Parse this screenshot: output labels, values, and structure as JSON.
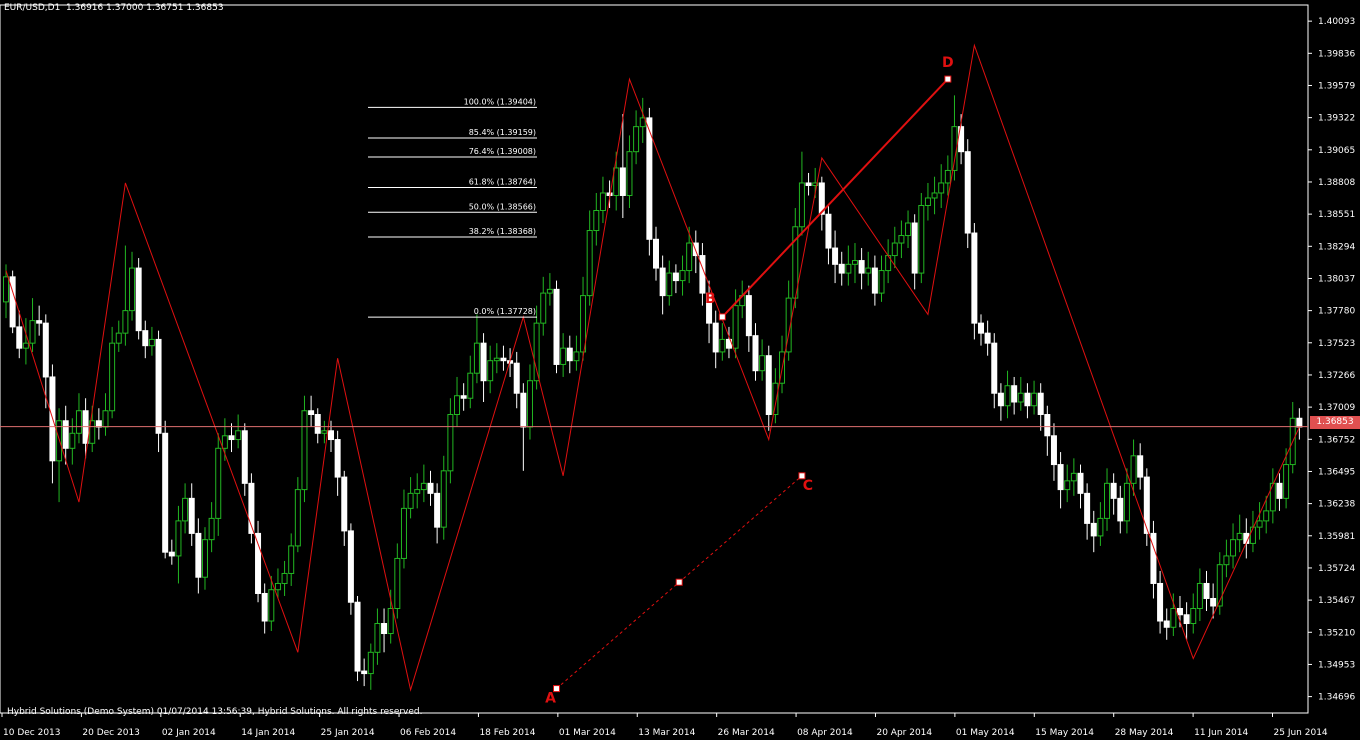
{
  "header": {
    "symbol": "EUR/USD,D1",
    "open": "1.36916",
    "high": "1.37000",
    "low": "1.36751",
    "close": "1.36853"
  },
  "footer": "Hybrid Solutions (Demo System) 01/07/2014 13:56:39, Hybrid Solutions. All rights reserved.",
  "current_price": "1.36853",
  "colors": {
    "background": "#000000",
    "bull": "#22b722",
    "bear": "#ffffff",
    "zigzag": "#e01010",
    "price_line": "#e07070",
    "axis_text": "#ffffff",
    "pattern_label": "#e01010"
  },
  "price_axis": [
    "1.40093",
    "1.39836",
    "1.39579",
    "1.39322",
    "1.39065",
    "1.38808",
    "1.38551",
    "1.38294",
    "1.38037",
    "1.37780",
    "1.37523",
    "1.37266",
    "1.37009",
    "1.36752",
    "1.36495",
    "1.36238",
    "1.35981",
    "1.35724",
    "1.35467",
    "1.35210",
    "1.34953",
    "1.34696"
  ],
  "time_axis": [
    "10 Dec 2013",
    "20 Dec 2013",
    "02 Jan 2014",
    "14 Jan 2014",
    "25 Jan 2014",
    "06 Feb 2014",
    "18 Feb 2014",
    "01 Mar 2014",
    "13 Mar 2014",
    "26 Mar 2014",
    "08 Apr 2014",
    "20 Apr 2014",
    "01 May 2014",
    "15 May 2014",
    "28 May 2014",
    "11 Jun 2014",
    "25 Jun 2014"
  ],
  "fib_levels": [
    {
      "label": "100.0% (1.39404)",
      "price": 1.39404
    },
    {
      "label": "85.4% (1.39159)",
      "price": 1.39159
    },
    {
      "label": "76.4% (1.39008)",
      "price": 1.39008
    },
    {
      "label": "61.8% (1.38764)",
      "price": 1.38764
    },
    {
      "label": "50.0% (1.38566)",
      "price": 1.38566
    },
    {
      "label": "38.2% (1.38368)",
      "price": 1.38368
    },
    {
      "label": "0.0% (1.37728)",
      "price": 1.37728
    }
  ],
  "pattern_points": [
    {
      "name": "A",
      "price": 1.3476
    },
    {
      "name": "B",
      "price": 1.3773
    },
    {
      "name": "C",
      "price": 1.3646
    },
    {
      "name": "D",
      "price": 1.3963
    }
  ],
  "chart_data": {
    "type": "candlestick",
    "symbol": "EUR/USD,D1",
    "ylim": [
      1.3455,
      1.402
    ],
    "zigzag": [
      1.381,
      1.3625,
      1.388,
      1.3505,
      1.374,
      1.3475,
      1.3773,
      1.3646,
      1.3963,
      1.3675,
      1.39,
      1.3775,
      1.399,
      1.35,
      1.3685
    ],
    "candles": [
      [
        1.3785,
        1.3805,
        1.3815,
        1.3772
      ],
      [
        1.3805,
        1.3765,
        1.381,
        1.376
      ],
      [
        1.3765,
        1.3748,
        1.3778,
        1.374
      ],
      [
        1.3748,
        1.3752,
        1.3772,
        1.3735
      ],
      [
        1.3752,
        1.377,
        1.3788,
        1.3745
      ],
      [
        1.377,
        1.3768,
        1.3782,
        1.3758
      ],
      [
        1.3768,
        1.3725,
        1.3775,
        1.37
      ],
      [
        1.3725,
        1.3658,
        1.3735,
        1.364
      ],
      [
        1.3658,
        1.369,
        1.37,
        1.3625
      ],
      [
        1.369,
        1.3668,
        1.3702,
        1.3655
      ],
      [
        1.3668,
        1.368,
        1.3692,
        1.3655
      ],
      [
        1.368,
        1.3698,
        1.3712,
        1.3672
      ],
      [
        1.3698,
        1.3672,
        1.3708,
        1.366
      ],
      [
        1.3672,
        1.369,
        1.3702,
        1.3665
      ],
      [
        1.369,
        1.3685,
        1.37,
        1.3675
      ],
      [
        1.3685,
        1.3698,
        1.3712,
        1.3678
      ],
      [
        1.3698,
        1.3752,
        1.3765,
        1.3692
      ],
      [
        1.3752,
        1.376,
        1.377,
        1.3745
      ],
      [
        1.376,
        1.3778,
        1.383,
        1.375
      ],
      [
        1.3778,
        1.3812,
        1.3825,
        1.377
      ],
      [
        1.3812,
        1.3762,
        1.382,
        1.3755
      ],
      [
        1.3762,
        1.375,
        1.377,
        1.374
      ],
      [
        1.375,
        1.3755,
        1.3765,
        1.3742
      ],
      [
        1.3755,
        1.368,
        1.3762,
        1.3665
      ],
      [
        1.368,
        1.3585,
        1.369,
        1.358
      ],
      [
        1.3585,
        1.3582,
        1.3595,
        1.3575
      ],
      [
        1.3582,
        1.361,
        1.3622,
        1.356
      ],
      [
        1.361,
        1.3628,
        1.364,
        1.36
      ],
      [
        1.3628,
        1.36,
        1.364,
        1.359
      ],
      [
        1.36,
        1.3565,
        1.3612,
        1.3552
      ],
      [
        1.3565,
        1.3595,
        1.3605,
        1.3555
      ],
      [
        1.3595,
        1.3612,
        1.3625,
        1.3585
      ],
      [
        1.3612,
        1.3668,
        1.368,
        1.3598
      ],
      [
        1.3668,
        1.3678,
        1.3692,
        1.3658
      ],
      [
        1.3678,
        1.3675,
        1.3688,
        1.3665
      ],
      [
        1.3675,
        1.3682,
        1.3695,
        1.3668
      ],
      [
        1.3682,
        1.364,
        1.3688,
        1.363
      ],
      [
        1.364,
        1.36,
        1.3648,
        1.3592
      ],
      [
        1.36,
        1.3552,
        1.361,
        1.3545
      ],
      [
        1.3552,
        1.353,
        1.356,
        1.352
      ],
      [
        1.353,
        1.3555,
        1.3566,
        1.3522
      ],
      [
        1.3555,
        1.356,
        1.3572,
        1.3548
      ],
      [
        1.356,
        1.3568,
        1.3578,
        1.355
      ],
      [
        1.3568,
        1.359,
        1.36,
        1.3558
      ],
      [
        1.359,
        1.3635,
        1.3645,
        1.3585
      ],
      [
        1.3635,
        1.3698,
        1.371,
        1.3625
      ],
      [
        1.3698,
        1.3695,
        1.371,
        1.3685
      ],
      [
        1.3695,
        1.368,
        1.37,
        1.3672
      ],
      [
        1.368,
        1.3682,
        1.369,
        1.3672
      ],
      [
        1.3682,
        1.3675,
        1.369,
        1.3665
      ],
      [
        1.3675,
        1.3645,
        1.3682,
        1.363
      ],
      [
        1.3645,
        1.3602,
        1.365,
        1.359
      ],
      [
        1.3602,
        1.3545,
        1.3608,
        1.3535
      ],
      [
        1.3545,
        1.349,
        1.355,
        1.3482
      ],
      [
        1.349,
        1.3488,
        1.35,
        1.3478
      ],
      [
        1.3488,
        1.3505,
        1.3512,
        1.3475
      ],
      [
        1.3505,
        1.3528,
        1.354,
        1.3495
      ],
      [
        1.3528,
        1.352,
        1.354,
        1.3505
      ],
      [
        1.352,
        1.354,
        1.3555,
        1.3512
      ],
      [
        1.354,
        1.358,
        1.3592,
        1.3532
      ],
      [
        1.358,
        1.362,
        1.3635,
        1.3572
      ],
      [
        1.362,
        1.3632,
        1.3645,
        1.3612
      ],
      [
        1.3632,
        1.3635,
        1.3648,
        1.362
      ],
      [
        1.3635,
        1.364,
        1.3655,
        1.3625
      ],
      [
        1.364,
        1.3632,
        1.365,
        1.3622
      ],
      [
        1.3632,
        1.3605,
        1.364,
        1.3592
      ],
      [
        1.3605,
        1.365,
        1.3662,
        1.3595
      ],
      [
        1.365,
        1.3695,
        1.3708,
        1.364
      ],
      [
        1.3695,
        1.371,
        1.3725,
        1.3685
      ],
      [
        1.371,
        1.3708,
        1.372,
        1.3698
      ],
      [
        1.3708,
        1.3728,
        1.3742,
        1.37
      ],
      [
        1.3728,
        1.3752,
        1.3775,
        1.372
      ],
      [
        1.3752,
        1.3722,
        1.376,
        1.3705
      ],
      [
        1.3722,
        1.3738,
        1.375,
        1.3712
      ],
      [
        1.3738,
        1.374,
        1.3752,
        1.3728
      ],
      [
        1.374,
        1.3738,
        1.375,
        1.373
      ],
      [
        1.3738,
        1.3736,
        1.3748,
        1.3725
      ],
      [
        1.3736,
        1.3712,
        1.3745,
        1.37
      ],
      [
        1.3712,
        1.3685,
        1.372,
        1.365
      ],
      [
        1.3685,
        1.3722,
        1.3735,
        1.3675
      ],
      [
        1.3722,
        1.3768,
        1.3782,
        1.3715
      ],
      [
        1.3768,
        1.3792,
        1.3805,
        1.3758
      ],
      [
        1.3792,
        1.3795,
        1.3808,
        1.3782
      ],
      [
        1.3795,
        1.3735,
        1.3802,
        1.3728
      ],
      [
        1.3735,
        1.3748,
        1.376,
        1.3725
      ],
      [
        1.3748,
        1.3738,
        1.3758,
        1.3728
      ],
      [
        1.3738,
        1.3745,
        1.3758,
        1.373
      ],
      [
        1.3745,
        1.379,
        1.3805,
        1.3738
      ],
      [
        1.379,
        1.3842,
        1.3858,
        1.3782
      ],
      [
        1.3842,
        1.3858,
        1.3872,
        1.383
      ],
      [
        1.3858,
        1.3872,
        1.3885,
        1.3848
      ],
      [
        1.3872,
        1.387,
        1.3882,
        1.386
      ],
      [
        1.387,
        1.3892,
        1.3905,
        1.3858
      ],
      [
        1.3892,
        1.387,
        1.3935,
        1.3852
      ],
      [
        1.387,
        1.3905,
        1.3918,
        1.386
      ],
      [
        1.3905,
        1.3925,
        1.3938,
        1.3895
      ],
      [
        1.3925,
        1.3932,
        1.3948,
        1.3912
      ],
      [
        1.3932,
        1.3835,
        1.394,
        1.3822
      ],
      [
        1.3835,
        1.3812,
        1.3845,
        1.3802
      ],
      [
        1.3812,
        1.379,
        1.3822,
        1.3775
      ],
      [
        1.379,
        1.3808,
        1.3818,
        1.3782
      ],
      [
        1.3808,
        1.3802,
        1.3815,
        1.3792
      ],
      [
        1.3802,
        1.381,
        1.3822,
        1.379
      ],
      [
        1.381,
        1.3832,
        1.3845,
        1.38
      ],
      [
        1.3832,
        1.3822,
        1.3842,
        1.3808
      ],
      [
        1.3822,
        1.3792,
        1.3832,
        1.3782
      ],
      [
        1.3792,
        1.3768,
        1.3802,
        1.3752
      ],
      [
        1.3768,
        1.3745,
        1.3778,
        1.3732
      ],
      [
        1.3745,
        1.3755,
        1.3768,
        1.3738
      ],
      [
        1.3755,
        1.3748,
        1.3765,
        1.374
      ],
      [
        1.3748,
        1.3782,
        1.3795,
        1.374
      ],
      [
        1.3782,
        1.379,
        1.3802,
        1.3772
      ],
      [
        1.379,
        1.3758,
        1.3798,
        1.3745
      ],
      [
        1.3758,
        1.373,
        1.3768,
        1.3722
      ],
      [
        1.373,
        1.3742,
        1.3755,
        1.3722
      ],
      [
        1.3742,
        1.3695,
        1.375,
        1.3682
      ],
      [
        1.3695,
        1.372,
        1.3732,
        1.3688
      ],
      [
        1.372,
        1.3745,
        1.3758,
        1.3712
      ],
      [
        1.3745,
        1.3788,
        1.3802,
        1.3738
      ],
      [
        1.3788,
        1.3845,
        1.386,
        1.378
      ],
      [
        1.3845,
        1.388,
        1.3905,
        1.3838
      ],
      [
        1.388,
        1.3878,
        1.3888,
        1.387
      ],
      [
        1.3878,
        1.388,
        1.3892,
        1.3868
      ],
      [
        1.388,
        1.3855,
        1.3885,
        1.3842
      ],
      [
        1.3855,
        1.3828,
        1.3862,
        1.3815
      ],
      [
        1.3828,
        1.3815,
        1.3842,
        1.38
      ],
      [
        1.3815,
        1.3808,
        1.3825,
        1.3798
      ],
      [
        1.3808,
        1.3815,
        1.383,
        1.3798
      ],
      [
        1.3815,
        1.3818,
        1.3832,
        1.38
      ],
      [
        1.3818,
        1.3808,
        1.3828,
        1.3795
      ],
      [
        1.3808,
        1.3812,
        1.3825,
        1.3798
      ],
      [
        1.3812,
        1.3792,
        1.3822,
        1.3782
      ],
      [
        1.3792,
        1.381,
        1.3822,
        1.3785
      ],
      [
        1.381,
        1.3822,
        1.3835,
        1.38
      ],
      [
        1.3822,
        1.3832,
        1.3845,
        1.3812
      ],
      [
        1.3832,
        1.3838,
        1.385,
        1.382
      ],
      [
        1.3838,
        1.3848,
        1.3858,
        1.3828
      ],
      [
        1.3848,
        1.3808,
        1.3855,
        1.3795
      ],
      [
        1.3808,
        1.3862,
        1.3872,
        1.38
      ],
      [
        1.3862,
        1.3868,
        1.388,
        1.385
      ],
      [
        1.3868,
        1.3872,
        1.3885,
        1.3855
      ],
      [
        1.3872,
        1.388,
        1.3895,
        1.386
      ],
      [
        1.388,
        1.389,
        1.3902,
        1.387
      ],
      [
        1.389,
        1.3925,
        1.395,
        1.3882
      ],
      [
        1.3925,
        1.3905,
        1.3935,
        1.3895
      ],
      [
        1.3905,
        1.384,
        1.3915,
        1.3828
      ],
      [
        1.384,
        1.3768,
        1.3848,
        1.3755
      ],
      [
        1.3768,
        1.376,
        1.3775,
        1.375
      ],
      [
        1.376,
        1.3752,
        1.377,
        1.3742
      ],
      [
        1.3752,
        1.3712,
        1.376,
        1.37
      ],
      [
        1.3712,
        1.3702,
        1.372,
        1.369
      ],
      [
        1.3702,
        1.3718,
        1.373,
        1.3692
      ],
      [
        1.3718,
        1.3705,
        1.3725,
        1.3695
      ],
      [
        1.3705,
        1.3712,
        1.3725,
        1.3698
      ],
      [
        1.3712,
        1.3702,
        1.372,
        1.3692
      ],
      [
        1.3702,
        1.3712,
        1.3722,
        1.3695
      ],
      [
        1.3712,
        1.3695,
        1.372,
        1.3682
      ],
      [
        1.3695,
        1.3678,
        1.3702,
        1.3662
      ],
      [
        1.3678,
        1.3655,
        1.3688,
        1.3642
      ],
      [
        1.3655,
        1.3635,
        1.3665,
        1.362
      ],
      [
        1.3635,
        1.3642,
        1.3655,
        1.3625
      ],
      [
        1.3642,
        1.3648,
        1.366,
        1.363
      ],
      [
        1.3648,
        1.3632,
        1.3655,
        1.362
      ],
      [
        1.3632,
        1.3608,
        1.364,
        1.3595
      ],
      [
        1.3608,
        1.3598,
        1.3618,
        1.3585
      ],
      [
        1.3598,
        1.3612,
        1.3625,
        1.359
      ],
      [
        1.3612,
        1.364,
        1.3652,
        1.3602
      ],
      [
        1.364,
        1.3628,
        1.3648,
        1.3615
      ],
      [
        1.3628,
        1.361,
        1.3638,
        1.36
      ],
      [
        1.361,
        1.364,
        1.3652,
        1.36
      ],
      [
        1.364,
        1.3662,
        1.3675,
        1.363
      ],
      [
        1.3662,
        1.3645,
        1.3672,
        1.3635
      ],
      [
        1.3645,
        1.36,
        1.3652,
        1.359
      ],
      [
        1.36,
        1.356,
        1.361,
        1.3548
      ],
      [
        1.356,
        1.353,
        1.357,
        1.352
      ],
      [
        1.353,
        1.3525,
        1.354,
        1.3515
      ],
      [
        1.3525,
        1.354,
        1.3552,
        1.3518
      ],
      [
        1.354,
        1.3535,
        1.355,
        1.3525
      ],
      [
        1.3535,
        1.3528,
        1.3545,
        1.3515
      ],
      [
        1.3528,
        1.354,
        1.3552,
        1.352
      ],
      [
        1.354,
        1.356,
        1.3572,
        1.353
      ],
      [
        1.356,
        1.3548,
        1.357,
        1.3538
      ],
      [
        1.3548,
        1.3542,
        1.356,
        1.3532
      ],
      [
        1.3542,
        1.3575,
        1.3585,
        1.3535
      ],
      [
        1.3575,
        1.3582,
        1.3595,
        1.3565
      ],
      [
        1.3582,
        1.3595,
        1.3608,
        1.3572
      ],
      [
        1.3595,
        1.36,
        1.3615,
        1.3585
      ],
      [
        1.36,
        1.3592,
        1.3612,
        1.358
      ],
      [
        1.3592,
        1.3605,
        1.3618,
        1.3585
      ],
      [
        1.3605,
        1.361,
        1.3625,
        1.3595
      ],
      [
        1.361,
        1.3618,
        1.363,
        1.36
      ],
      [
        1.3618,
        1.364,
        1.3652,
        1.3608
      ],
      [
        1.364,
        1.3628,
        1.3648,
        1.3618
      ],
      [
        1.3628,
        1.3655,
        1.3668,
        1.362
      ],
      [
        1.3655,
        1.3692,
        1.3705,
        1.3648
      ],
      [
        1.3692,
        1.3685,
        1.37,
        1.3675
      ]
    ]
  }
}
